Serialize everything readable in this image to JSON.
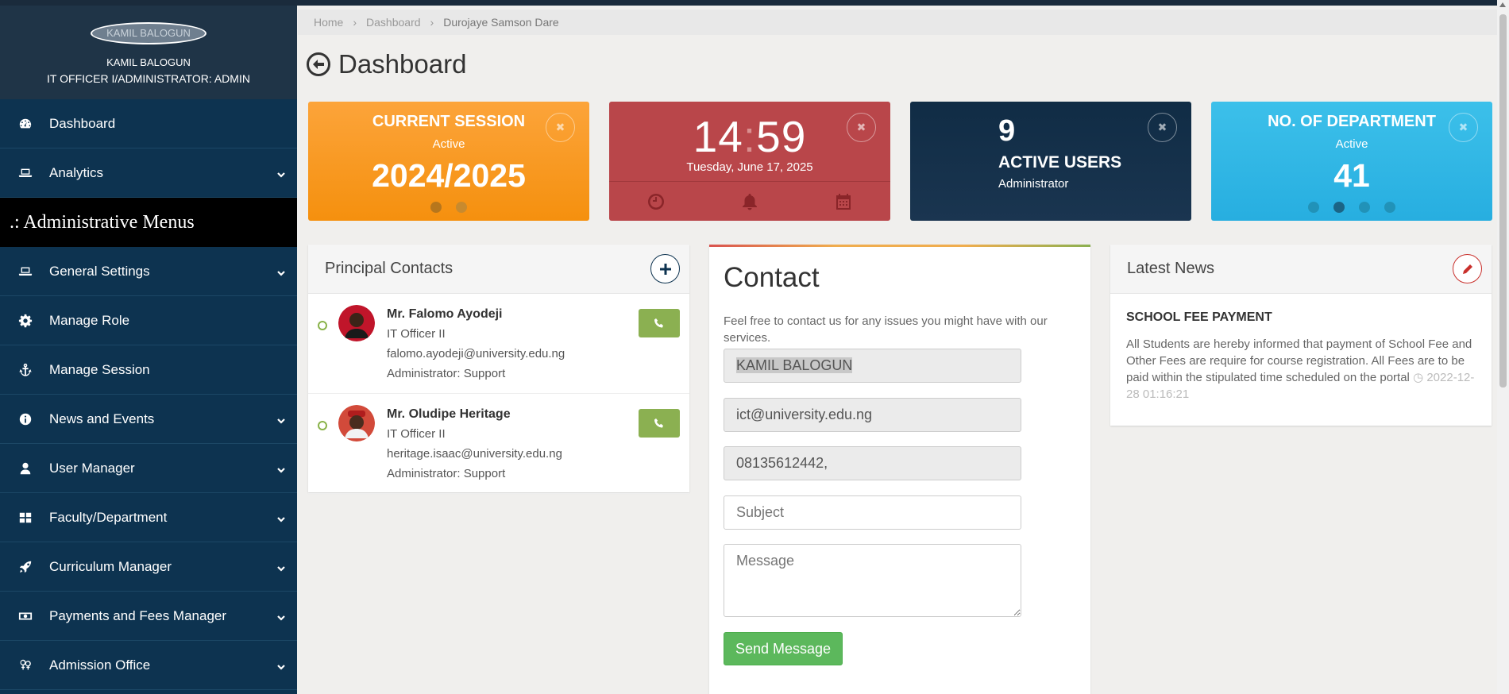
{
  "profile": {
    "avatar_alt": "KAMIL BALOGUN",
    "name": "KAMIL BALOGUN",
    "role": "IT OFFICER I/ADMINISTRATOR: ADMIN"
  },
  "sidebar": {
    "items_top": [
      {
        "label": "Dashboard",
        "icon": "dashboard-icon",
        "has_chevron": false
      },
      {
        "label": "Analytics",
        "icon": "laptop-icon",
        "has_chevron": true
      }
    ],
    "section_header": ".: Administrative Menus",
    "items": [
      {
        "label": "General Settings",
        "icon": "laptop-icon"
      },
      {
        "label": "Manage Role",
        "icon": "gear-icon"
      },
      {
        "label": "Manage Session",
        "icon": "anchor-icon"
      },
      {
        "label": "News and Events",
        "icon": "info-icon"
      },
      {
        "label": "User Manager",
        "icon": "user-icon"
      },
      {
        "label": "Faculty/Department",
        "icon": "grid-icon"
      },
      {
        "label": "Curriculum Manager",
        "icon": "rocket-icon"
      },
      {
        "label": "Payments and Fees Manager",
        "icon": "money-icon"
      },
      {
        "label": "Admission Office",
        "icon": "gender-icon"
      }
    ]
  },
  "breadcrumb": {
    "home": "Home",
    "dashboard": "Dashboard",
    "current": "Durojaye Samson Dare"
  },
  "page": {
    "title": "Dashboard"
  },
  "cards": {
    "session": {
      "title": "CURRENT SESSION",
      "status": "Active",
      "value": "2024/2025"
    },
    "clock": {
      "hours": "14",
      "minutes": "59",
      "date": "Tuesday, June 17, 2025"
    },
    "users": {
      "count": "9",
      "label": "ACTIVE USERS",
      "role": "Administrator"
    },
    "department": {
      "title": "NO. OF DEPARTMENT",
      "status": "Active",
      "value": "41"
    }
  },
  "principal_contacts": {
    "title": "Principal Contacts",
    "people": [
      {
        "name": "Mr. Falomo Ayodeji",
        "position": "IT Officer II",
        "email": "falomo.ayodeji@university.edu.ng",
        "group": "Administrator: Support"
      },
      {
        "name": "Mr. Oludipe Heritage",
        "position": "IT Officer II",
        "email": "heritage.isaac@university.edu.ng",
        "group": "Administrator: Support"
      }
    ]
  },
  "contact_form": {
    "title": "Contact",
    "description": "Feel free to contact us for any issues you might have with our services.",
    "name_value": "KAMIL BALOGUN",
    "email_value": "ict@university.edu.ng",
    "phone_value": "08135612442,",
    "subject_placeholder": "Subject",
    "message_placeholder": "Message",
    "send_label": "Send Message"
  },
  "news": {
    "title": "Latest News",
    "item_title": "SCHOOL FEE PAYMENT",
    "item_body": "All Students are hereby informed that payment of School Fee and Other Fees are require for course registration. All Fees are to be paid within the stipulated time scheduled on the portal",
    "item_date": "2022-12-28 01:16:21"
  },
  "colors": {
    "sidebar": "#0d3350",
    "orange": "#f7960f",
    "red": "#b9464a",
    "navy": "#102c45",
    "cyan": "#27aee0",
    "green": "#5cb85c"
  }
}
